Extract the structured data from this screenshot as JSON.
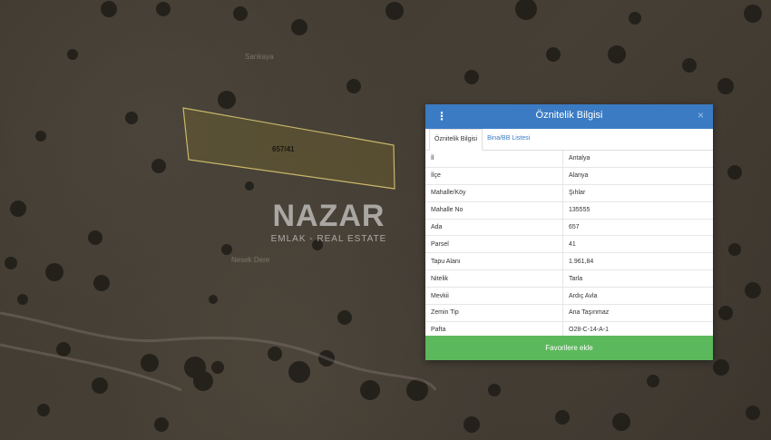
{
  "map": {
    "parcel_label": "657/41",
    "faint_label_1": "Sarıkaya",
    "faint_label_2": "Nesek Dere"
  },
  "watermark": {
    "title": "NAZAR",
    "subtitle": "EMLAK - REAL ESTATE"
  },
  "panel": {
    "title": "Öznitelik Bilgisi",
    "menu_icon": "⋮",
    "close_icon": "×",
    "tabs": [
      {
        "label": "Öznitelik Bilgisi"
      },
      {
        "label": "Bina/BB Listesi"
      }
    ],
    "rows": [
      {
        "key": "İl",
        "value": "Antalya"
      },
      {
        "key": "İlçe",
        "value": "Alanya"
      },
      {
        "key": "Mahalle/Köy",
        "value": "Şıhlar"
      },
      {
        "key": "Mahalle No",
        "value": "135555"
      },
      {
        "key": "Ada",
        "value": "657"
      },
      {
        "key": "Parsel",
        "value": "41"
      },
      {
        "key": "Tapu Alanı",
        "value": "1.961,84"
      },
      {
        "key": "Nitelik",
        "value": "Tarla"
      },
      {
        "key": "Mevkii",
        "value": "Ardıç Avla"
      },
      {
        "key": "Zemin Tip",
        "value": "Ana Taşınmaz"
      },
      {
        "key": "Pafta",
        "value": "O28-C-14-A-1"
      }
    ],
    "favorite_button": "Favorilere ekle"
  },
  "colors": {
    "header": "#3a7bc4",
    "button": "#5cb85c",
    "parcel_outline": "#c9b86a"
  }
}
